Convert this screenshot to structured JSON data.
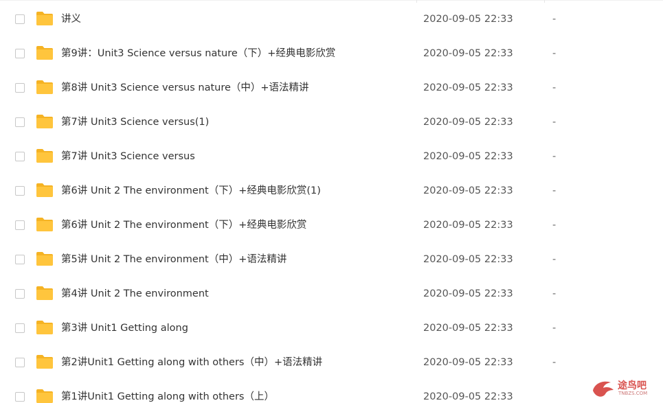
{
  "files": [
    {
      "name": "讲义",
      "date": "2020-09-05 22:33",
      "size": "-"
    },
    {
      "name": "第9讲：Unit3 Science versus nature（下）+经典电影欣赏",
      "date": "2020-09-05 22:33",
      "size": "-"
    },
    {
      "name": "第8讲 Unit3 Science versus nature（中）+语法精讲",
      "date": "2020-09-05 22:33",
      "size": "-"
    },
    {
      "name": "第7讲 Unit3 Science versus(1)",
      "date": "2020-09-05 22:33",
      "size": "-"
    },
    {
      "name": "第7讲 Unit3 Science versus",
      "date": "2020-09-05 22:33",
      "size": "-"
    },
    {
      "name": "第6讲 Unit 2 The environment（下）+经典电影欣赏(1)",
      "date": "2020-09-05 22:33",
      "size": "-"
    },
    {
      "name": "第6讲 Unit 2 The environment（下）+经典电影欣赏",
      "date": "2020-09-05 22:33",
      "size": "-"
    },
    {
      "name": "第5讲 Unit 2 The environment（中）+语法精讲",
      "date": "2020-09-05 22:33",
      "size": "-"
    },
    {
      "name": "第4讲 Unit 2 The environment",
      "date": "2020-09-05 22:33",
      "size": "-"
    },
    {
      "name": "第3讲 Unit1 Getting along",
      "date": "2020-09-05 22:33",
      "size": "-"
    },
    {
      "name": "第2讲Unit1 Getting along with others（中）+语法精讲",
      "date": "2020-09-05 22:33",
      "size": "-"
    },
    {
      "name": "第1讲Unit1 Getting along with others（上）",
      "date": "2020-09-05 22:33",
      "size": ""
    }
  ],
  "watermark": {
    "text": "途鸟吧",
    "sub": "TNBZS.COM"
  },
  "colors": {
    "folder": "#ffc53d",
    "folder_dark": "#f5b324"
  }
}
